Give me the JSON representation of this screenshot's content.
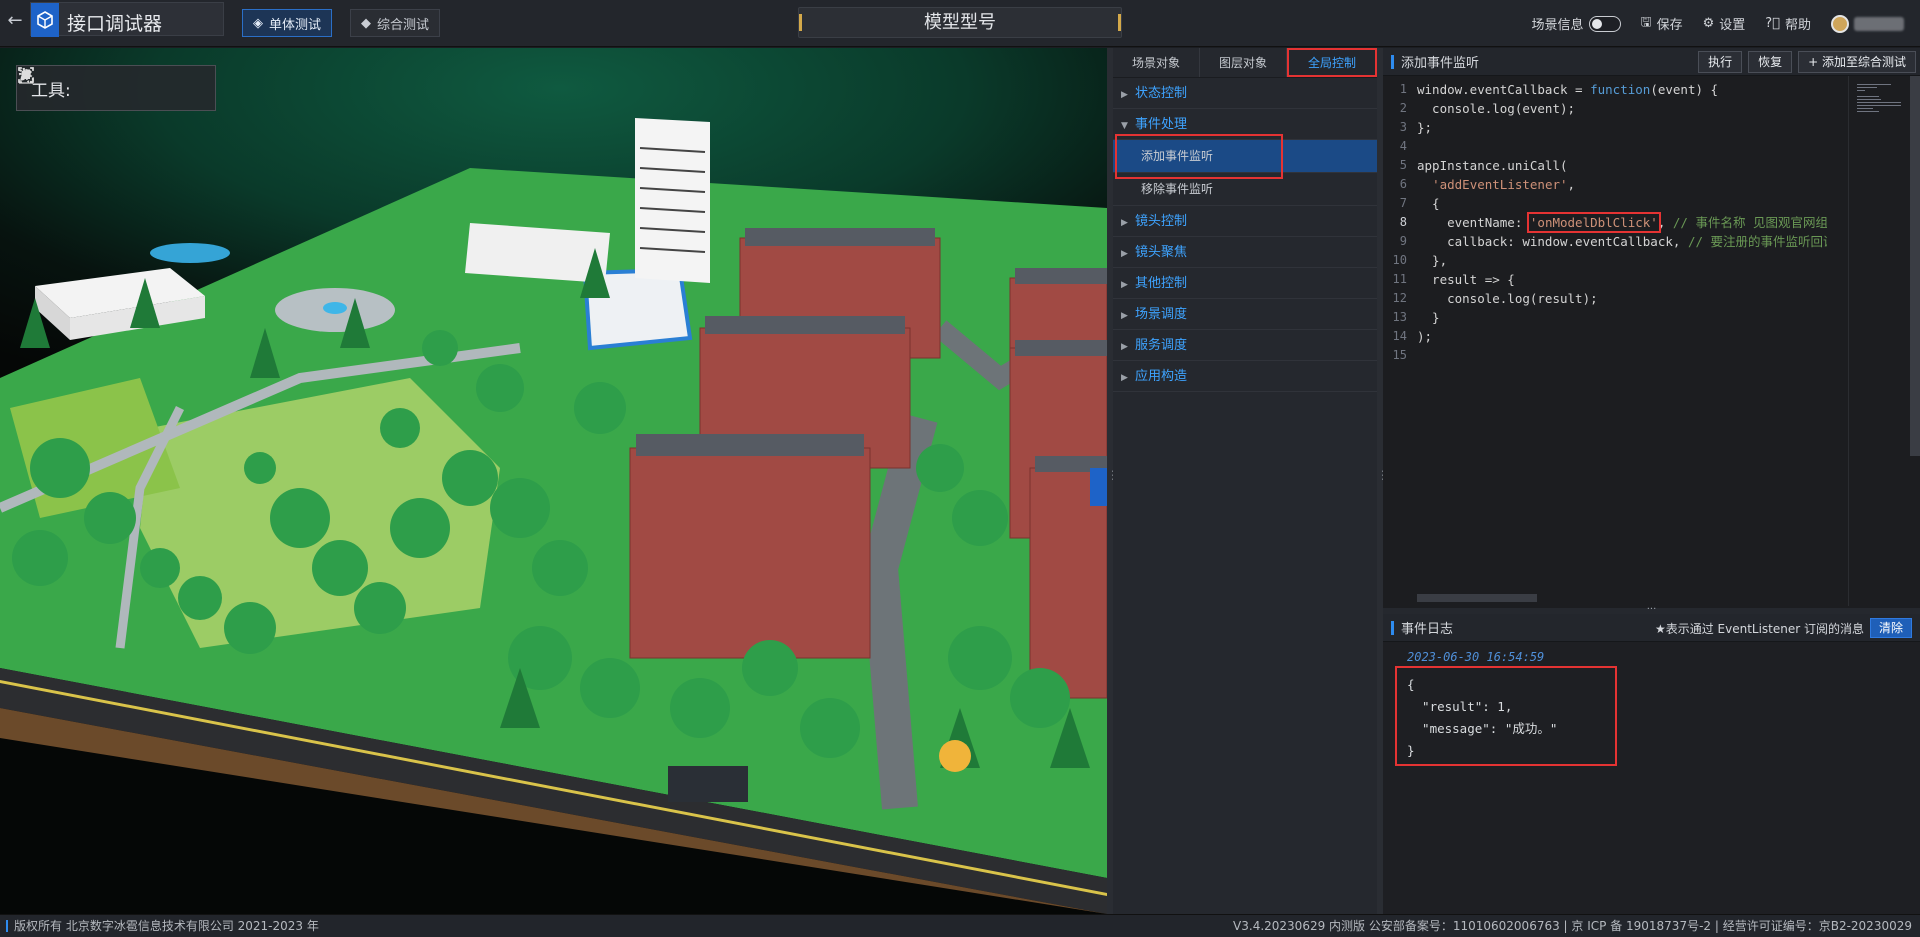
{
  "header": {
    "app_title": "接口调试器",
    "mode_single": "单体测试",
    "mode_combined": "综合测试",
    "model_title": "模型型号",
    "scene_info": "场景信息",
    "save": "保存",
    "settings": "设置",
    "help": "帮助"
  },
  "viewport": {
    "toolbar_label": "工具:"
  },
  "side": {
    "tabs": [
      "场景对象",
      "图层对象",
      "全局控制"
    ],
    "active_tab": "全局控制",
    "tree": [
      {
        "label": "状态控制",
        "expanded": false
      },
      {
        "label": "事件处理",
        "expanded": true,
        "children": [
          "添加事件监听",
          "移除事件监听"
        ],
        "selected": "添加事件监听"
      },
      {
        "label": "镜头控制",
        "expanded": false
      },
      {
        "label": "镜头聚焦",
        "expanded": false
      },
      {
        "label": "其他控制",
        "expanded": false
      },
      {
        "label": "场景调度",
        "expanded": false
      },
      {
        "label": "服务调度",
        "expanded": false
      },
      {
        "label": "应用构造",
        "expanded": false
      }
    ]
  },
  "editor": {
    "title": "添加事件监听",
    "run": "执行",
    "reset": "恢复",
    "add_to_combined": "添加至综合测试",
    "line_numbers": [
      "1",
      "2",
      "3",
      "4",
      "5",
      "6",
      "7",
      "8",
      "9",
      "10",
      "11",
      "12",
      "13",
      "14",
      "15"
    ],
    "current_line": 8,
    "event_name": "'onModelDblClick'",
    "comment_event": "// 事件名称 见图观官网组",
    "comment_callback": "// 要注册的事件监听回调"
  },
  "log": {
    "title": "事件日志",
    "note": "★表示通过 EventListener 订阅的消息",
    "clear": "清除",
    "timestamp": "2023-06-30 16:54:59",
    "lines": [
      "{",
      "  \"result\": 1,",
      "  \"message\": \"成功。\"",
      "}"
    ]
  },
  "footer": {
    "copyright": "版权所有 北京数字冰雹信息技术有限公司 2021-2023 年",
    "version": "V3.4.20230629 内测版 公安部备案号：11010602006763 | 京 ICP 备 19018737号-2 | 经营许可证编号：京B2-20230029"
  },
  "colors": {
    "accent": "#3ea3ff",
    "highlight_red": "#e53333",
    "selected_bg": "#1b4a86"
  }
}
